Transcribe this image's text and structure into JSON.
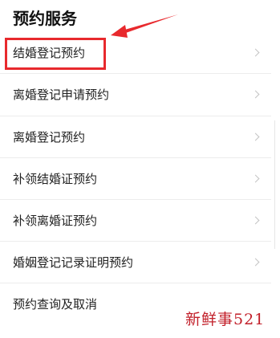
{
  "section": {
    "title": "预约服务"
  },
  "menu": {
    "items": [
      {
        "label": "结婚登记预约"
      },
      {
        "label": "离婚登记申请预约"
      },
      {
        "label": "离婚登记预约"
      },
      {
        "label": "补领结婚证预约"
      },
      {
        "label": "补领离婚证预约"
      },
      {
        "label": "婚姻登记记录证明预约"
      },
      {
        "label": "预约查询及取消"
      }
    ]
  },
  "annotation": {
    "highlight_color": "#e8292d"
  },
  "watermark": {
    "text": "新鲜事521",
    "color": "#c2202a"
  },
  "icons": {
    "chevron": "chevron-right-icon"
  }
}
